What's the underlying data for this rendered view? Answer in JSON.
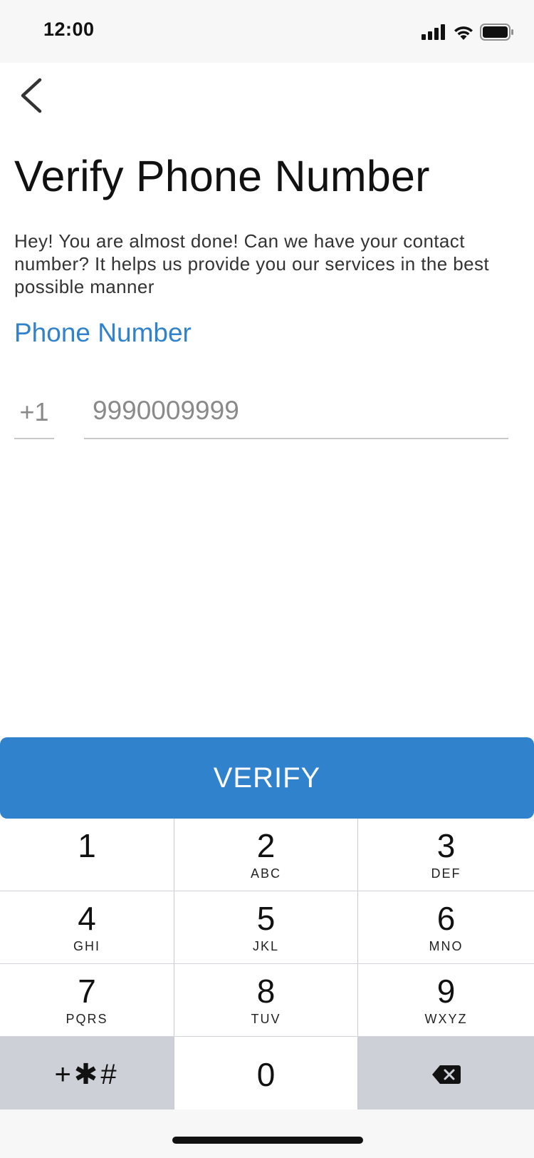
{
  "status_bar": {
    "time": "12:00",
    "icons": [
      "signal-icon",
      "wifi-icon",
      "battery-icon"
    ]
  },
  "nav": {
    "back_icon": "chevron-left-icon"
  },
  "title": "Verify Phone Number",
  "description": "Hey! You are almost done! Can we have your contact number? It helps us provide you our services in the best possible manner",
  "phone": {
    "label": "Phone Number",
    "country_code": "+1",
    "placeholder": "9990009999",
    "value": ""
  },
  "verify_button": {
    "label": "VERIFY"
  },
  "keypad": {
    "keys": [
      {
        "num": "1",
        "letters": ""
      },
      {
        "num": "2",
        "letters": "ABC"
      },
      {
        "num": "3",
        "letters": "DEF"
      },
      {
        "num": "4",
        "letters": "GHI"
      },
      {
        "num": "5",
        "letters": "JKL"
      },
      {
        "num": "6",
        "letters": "MNO"
      },
      {
        "num": "7",
        "letters": "PQRS"
      },
      {
        "num": "8",
        "letters": "TUV"
      },
      {
        "num": "9",
        "letters": "WXYZ"
      },
      {
        "num": "0",
        "letters": ""
      }
    ],
    "symbols": "+✱#",
    "delete_icon": "backspace-icon"
  },
  "colors": {
    "accent": "#2f82cb",
    "keypad_bg": "#d1d3d8",
    "status_bg": "#f7f7f7"
  }
}
